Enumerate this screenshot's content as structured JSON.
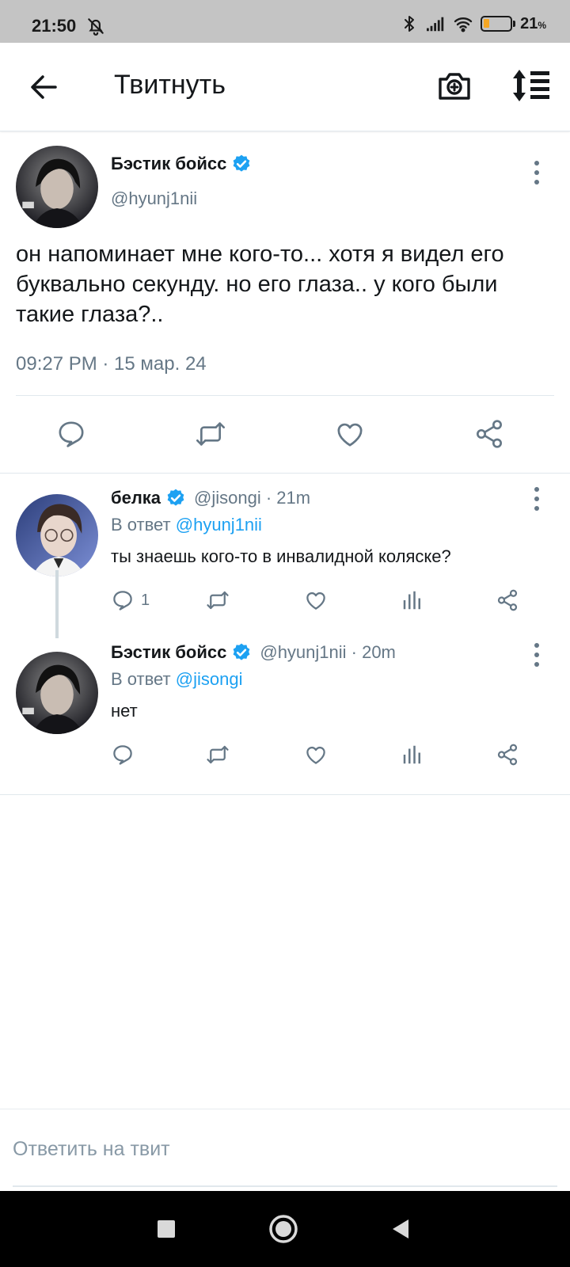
{
  "status_bar": {
    "time": "21:50",
    "battery_percent": "21",
    "battery_unit": "%",
    "battery_level": 0.21,
    "icons": [
      "bell-off-icon",
      "bluetooth-icon",
      "signal-icon",
      "wifi-icon",
      "battery-icon"
    ]
  },
  "header": {
    "title": "Твитнуть",
    "icons": [
      "back-arrow-icon",
      "camera-plus-icon",
      "sort-icon"
    ]
  },
  "main_tweet": {
    "author_name": "Бэстик бойсс",
    "handle": "@hyunj1nii",
    "text": "он напоминает мне кого-то... хотя я видел его буквально секунду. но его глаза..  у кого были такие глаза?..",
    "time": "09:27 PM · 15 мар. 24",
    "actions": [
      "reply-icon",
      "retweet-icon",
      "like-icon",
      "share-icon"
    ]
  },
  "replies": [
    {
      "author_name": "белка",
      "handle_time": "@jisongi · 21m",
      "reply_prefix": "В ответ",
      "reply_to": "@hyunj1nii",
      "text": "ты знаешь кого-то в инвалидной коляске?",
      "reply_count": "1"
    },
    {
      "author_name": "Бэстик бойсс",
      "handle_time": "@hyunj1nii · 20m",
      "reply_prefix": "В ответ",
      "reply_to": "@jisongi",
      "text": "нет",
      "reply_count": ""
    }
  ],
  "compose": {
    "placeholder": "Ответить на твит"
  },
  "colors": {
    "accent": "#1da1f2",
    "secondary_text": "#657786",
    "battery_fill": "#f5a623"
  }
}
